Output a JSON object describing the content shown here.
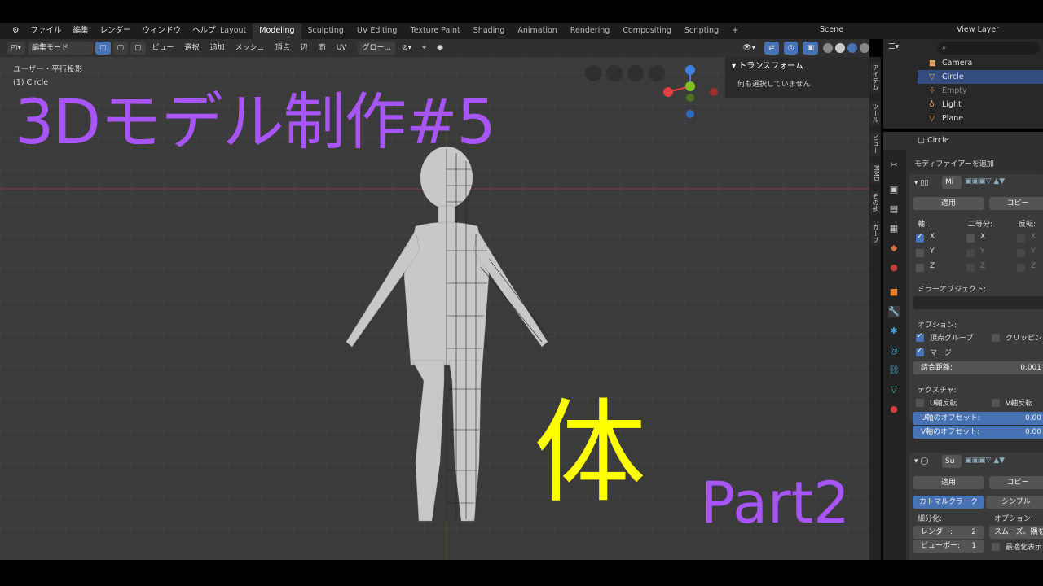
{
  "menus": [
    "ファイル",
    "編集",
    "レンダー",
    "ウィンドウ",
    "ヘルプ"
  ],
  "workspaces": [
    "Layout",
    "Modeling",
    "Sculpting",
    "UV Editing",
    "Texture Paint",
    "Shading",
    "Animation",
    "Rendering",
    "Compositing",
    "Scripting"
  ],
  "active_workspace": "Modeling",
  "scene": "Scene",
  "view_layer": "View Layer",
  "viewport": {
    "mode": "編集モード",
    "menu": [
      "ビュー",
      "選択",
      "追加",
      "メッシュ",
      "頂点",
      "辺",
      "面",
      "UV"
    ],
    "transform": "グロー...",
    "info_line1": "ユーザー・平行投影",
    "info_line2": "(1) Circle"
  },
  "overlay": {
    "title": "3Dモデル制作#5",
    "kanji": "体",
    "part": "Part2"
  },
  "npanel": {
    "title": "トランスフォーム",
    "message": "何も選択していません"
  },
  "side_tabs": [
    "アイテム",
    "ツール",
    "ビュー",
    "MMD",
    "その他",
    "カーブ"
  ],
  "outliner": [
    "Camera",
    "Circle",
    "Empty",
    "Light",
    "Plane"
  ],
  "outliner_selected": "Circle",
  "properties": {
    "object": "Circle",
    "add_modifier": "モディファイアーを追加",
    "mod1_name": "Mi",
    "apply": "適用",
    "copy": "コピー",
    "axis": "軸:",
    "bisect": "二等分:",
    "flip": "反転:",
    "x": "X",
    "y": "Y",
    "z": "Z",
    "mirror_object": "ミラーオブジェクト:",
    "options": "オプション:",
    "vertex_groups": "頂点グループ",
    "clipping": "クリッピン",
    "merge": "マージ",
    "merge_dist_label": "結合距離:",
    "merge_dist": "0.001",
    "textures": "テクスチャ:",
    "u_flip": "U軸反転",
    "v_flip": "V軸反転",
    "u_offset_label": "U軸のオフセット:",
    "u_offset": "0.00",
    "v_offset_label": "V軸のオフセット:",
    "v_offset": "0.00",
    "mod2_name": "Su",
    "catmull": "カトマルクラーク",
    "simple": "シンプル",
    "subdiv": "細分化:",
    "options2": "オプション:",
    "render_label": "レンダー:",
    "render_val": "2",
    "viewport_label": "ビューポー:",
    "viewport_val": "1",
    "smooth": "スムーズ、隅を",
    "optimal": "最適化表示"
  }
}
